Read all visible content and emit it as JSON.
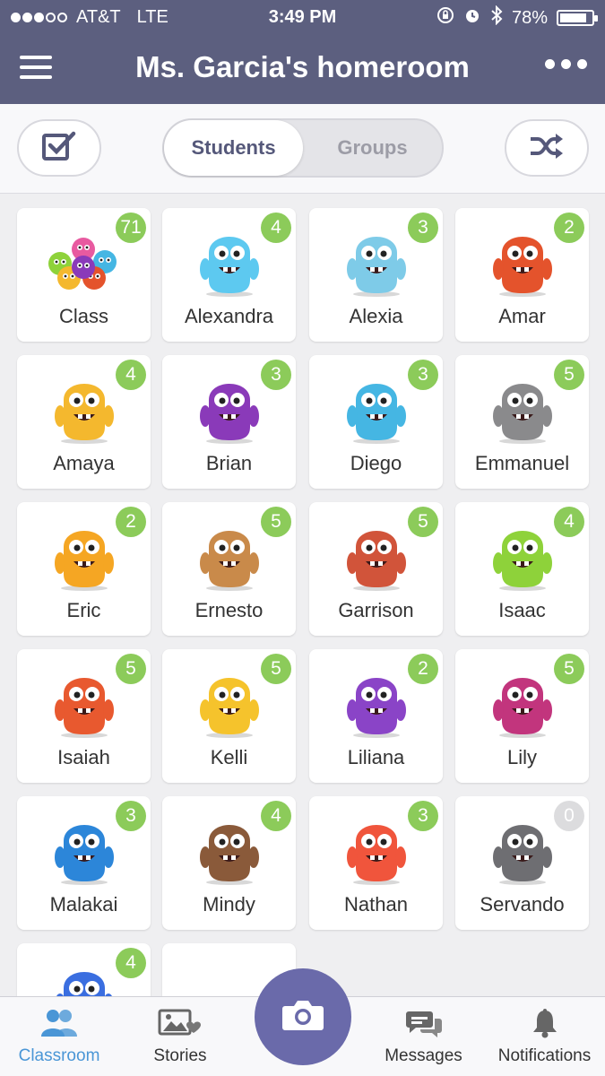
{
  "status_bar": {
    "carrier": "AT&T",
    "network": "LTE",
    "time": "3:49 PM",
    "battery": "78%"
  },
  "header": {
    "title": "Ms. Garcia's homeroom"
  },
  "toolbar": {
    "segment_students": "Students",
    "segment_groups": "Groups",
    "active_segment": "Students"
  },
  "students": [
    {
      "name": "Class",
      "points": "71"
    },
    {
      "name": "Alexandra",
      "points": "4"
    },
    {
      "name": "Alexia",
      "points": "3"
    },
    {
      "name": "Amar",
      "points": "2"
    },
    {
      "name": "Amaya",
      "points": "4"
    },
    {
      "name": "Brian",
      "points": "3"
    },
    {
      "name": "Diego",
      "points": "3"
    },
    {
      "name": "Emmanuel",
      "points": "5"
    },
    {
      "name": "Eric",
      "points": "2"
    },
    {
      "name": "Ernesto",
      "points": "5"
    },
    {
      "name": "Garrison",
      "points": "5"
    },
    {
      "name": "Isaac",
      "points": "4"
    },
    {
      "name": "Isaiah",
      "points": "5"
    },
    {
      "name": "Kelli",
      "points": "5"
    },
    {
      "name": "Liliana",
      "points": "2"
    },
    {
      "name": "Lily",
      "points": "5"
    },
    {
      "name": "Malakai",
      "points": "3"
    },
    {
      "name": "Mindy",
      "points": "4"
    },
    {
      "name": "Nathan",
      "points": "3"
    },
    {
      "name": "Servando",
      "points": "0"
    },
    {
      "name": "",
      "points": "4"
    }
  ],
  "bottom_nav": {
    "classroom": "Classroom",
    "stories": "Stories",
    "messages": "Messages",
    "notifications": "Notifications"
  },
  "colors": {
    "header_bg": "#5c5f7f",
    "badge_green": "#8ccb5a",
    "camera_purple": "#6a6aaa",
    "active_tab_blue": "#4a96d6"
  },
  "icons": [
    "hamburger-menu-icon",
    "more-options-icon",
    "checkbox-select-icon",
    "shuffle-icon",
    "classroom-people-icon",
    "stories-photo-icon",
    "camera-icon",
    "messages-bubble-icon",
    "notifications-bell-icon",
    "monster-avatar"
  ]
}
